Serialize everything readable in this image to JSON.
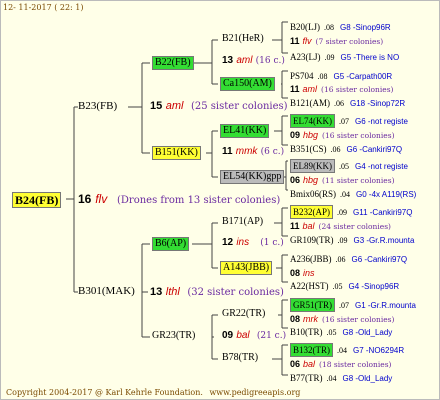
{
  "header": {
    "date": "12- 11-2017 ( 22: 1)"
  },
  "footer": {
    "copyright": "Copyright 2004-2017 @ Karl Kehrle Foundation.",
    "url": "www.pedigreeapis.org"
  },
  "root": {
    "name": "B24(FB)",
    "num": "16",
    "line": "flv",
    "desc": "(Drones from 13 sister colonies)"
  },
  "parents": [
    {
      "name": "B23(FB)",
      "num": "15",
      "line": "aml",
      "sis": "(25 sister colonies)"
    },
    {
      "name": "B301(MAK)",
      "num": "13",
      "line": "lthl",
      "sis": "(32 sister colonies)"
    }
  ],
  "gp": [
    {
      "name": "B22(FB)",
      "num": "13",
      "line": "aml",
      "sis": "(16 c.)"
    },
    {
      "name": "B151(KK)",
      "num": "11",
      "line": "mmk",
      "sis": "(6 c.)"
    },
    {
      "name": "B6(AP)",
      "num": "12",
      "line": "ins",
      "sis": "(1 c.)"
    },
    {
      "name": "GR23(TR)",
      "num": "09",
      "line": "bal",
      "sis": "(21 c.)"
    }
  ],
  "ggp": [
    {
      "name": "B21(HeR)"
    },
    {
      "name": "Ca150(AM)"
    },
    {
      "name": "EL41(KK)"
    },
    {
      "name": "EL54(KK)gpp"
    },
    {
      "name": "B171(AP)"
    },
    {
      "name": "A143(JBB)"
    },
    {
      "name": "GR22(TR)"
    },
    {
      "name": "B78(TR)"
    }
  ],
  "leaves": [
    {
      "name": "B20(LJ)",
      "val": ".08",
      "info": "G8 -Sinop96R"
    },
    {
      "num": "11",
      "line": "flv",
      "sis": "(7 sister colonies)"
    },
    {
      "name": "A23(LJ)",
      "val": ".09",
      "info": "G5 -There is NO"
    },
    {
      "name": "PS704",
      "val": ".08",
      "info": "G5 -Carpath00R"
    },
    {
      "num": "11",
      "line": "aml",
      "sis": "(16 sister colonies)"
    },
    {
      "name": "B121(AM)",
      "val": ".06",
      "info": "G18 -Sinop72R"
    },
    {
      "name": "EL74(KK)",
      "val": ".07",
      "info": "G6 -not registe"
    },
    {
      "num": "09",
      "line": "hbg",
      "sis": "(16 sister colonies)"
    },
    {
      "name": "B351(CS)",
      "val": ".06",
      "info": "G6 -Cankiri97Q"
    },
    {
      "name": "EL89(KK)",
      "val": ".05",
      "info": "G4 -not registe"
    },
    {
      "num": "06",
      "line": "hbg",
      "sis": "(11 sister colonies)"
    },
    {
      "name": "Bmix06(RS)",
      "val": ".04",
      "info": "G0 -4x A119(RS)"
    },
    {
      "name": "B232(AP)",
      "val": ".09",
      "info": "G11 -Cankiri97Q"
    },
    {
      "num": "11",
      "line": "bal",
      "sis": "(24 sister colonies)"
    },
    {
      "name": "GR109(TR)",
      "val": ".09",
      "info": "G3 -Gr.R.mounta"
    },
    {
      "name": "A236(JBB)",
      "val": ".06",
      "info": "G6 -Cankiri97Q"
    },
    {
      "num": "08",
      "line": "ins",
      "sis": ""
    },
    {
      "name": "A22(HST)",
      "val": ".05",
      "info": "G4 -Sinop96R"
    },
    {
      "name": "GR51(TR)",
      "val": ".07",
      "info": "G1 -Gr.R.mounta"
    },
    {
      "num": "08",
      "line": "mrk",
      "sis": "(16 sister colonies)"
    },
    {
      "name": "B10(TR)",
      "val": ".05",
      "info": "G8 -Old_Lady"
    },
    {
      "name": "B132(TR)",
      "val": ".04",
      "info": "G7 -NO6294R"
    },
    {
      "num": "06",
      "line": "bal",
      "sis": "(18 sister colonies)"
    },
    {
      "name": "B77(TR)",
      "val": ".04",
      "info": "G8 -Old_Lady"
    }
  ],
  "colors": {
    "green": "#33dd33",
    "yellow": "#ffff33",
    "grey": "#bbbbbb",
    "line": "#444444",
    "bg": "#ffffe8"
  }
}
